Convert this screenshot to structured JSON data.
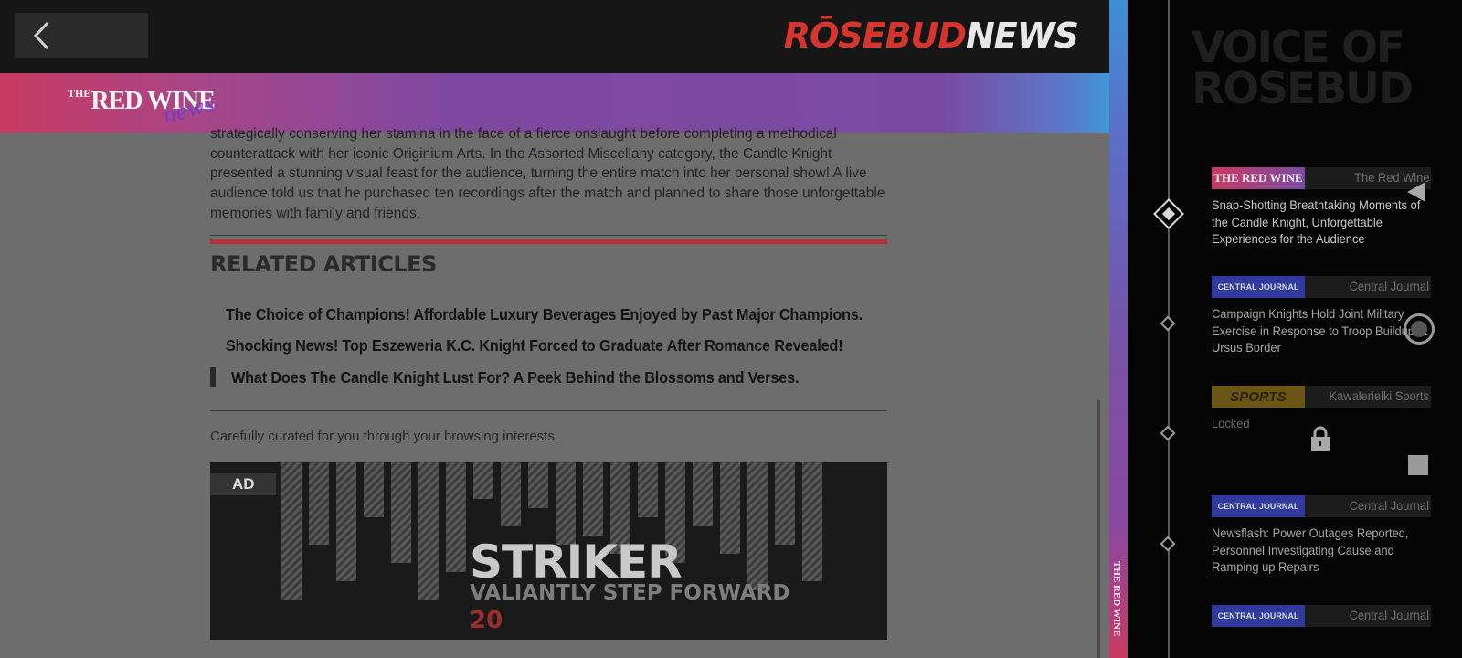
{
  "header": {
    "logo_part1": "RŌSEBUD",
    "logo_part2": "NEWS",
    "back_icon": "chevron-left-icon"
  },
  "band": {
    "brand_the": "THE",
    "brand_name": "RED WINE",
    "brand_script": "news"
  },
  "article": {
    "paragraph": "strategically conserving her stamina in the face of a fierce onslaught before completing a methodical counterattack with her iconic Originium Arts. In the Assorted Miscellany category, the Candle Knight presented a stunning visual feast for the audience, turning the entire match into her personal show! A live audience told us that he purchased ten recordings after the match and planned to share those unforgettable memories with family and friends."
  },
  "related": {
    "title": "RELATED ARTICLES",
    "items": [
      "The Choice of Champions! Affordable Luxury Beverages Enjoyed by Past Major Champions.",
      "Shocking News! Top Eszeweria K.C. Knight Forced to Graduate After Romance Revealed!",
      "What Does The Candle Knight Lust For? A Peek Behind the Blossoms and Verses."
    ]
  },
  "curated_text": "Carefully curated for you through your browsing interests.",
  "ad": {
    "label": "AD",
    "title": "STRIKER",
    "subtitle": "VALIANTLY STEP FORWARD",
    "number": "20"
  },
  "edge_text": "THE RED WINE",
  "sidebar": {
    "heading": "VOICE OF ROSEBUD",
    "entries": [
      {
        "badge": "THE RED WINE",
        "source": "The Red Wine",
        "headline": "Snap-Shotting Breathtaking Moments of the Candle Knight, Unforgettable Experiences for the Audience",
        "state": "active"
      },
      {
        "badge": "CENTRAL JOURNAL",
        "source": "Central Journal",
        "headline": "Campaign Knights Hold Joint Military Exercise in Response to Troop Buildup at Ursus Border",
        "state": "normal"
      },
      {
        "badge": "SPORTS",
        "source": "Kawalerielki Sports",
        "headline": "Locked",
        "state": "locked"
      },
      {
        "badge": "CENTRAL JOURNAL",
        "source": "Central Journal",
        "headline": "Newsflash: Power Outages Reported, Personnel Investigating Cause and Ramping up Repairs",
        "state": "normal"
      },
      {
        "badge": "CENTRAL JOURNAL",
        "source": "Central Journal",
        "headline": "",
        "state": "normal"
      }
    ]
  },
  "colors": {
    "accent_red": "#b73133",
    "band_pink": "#c93a63",
    "band_purple": "#7a4aa2"
  }
}
